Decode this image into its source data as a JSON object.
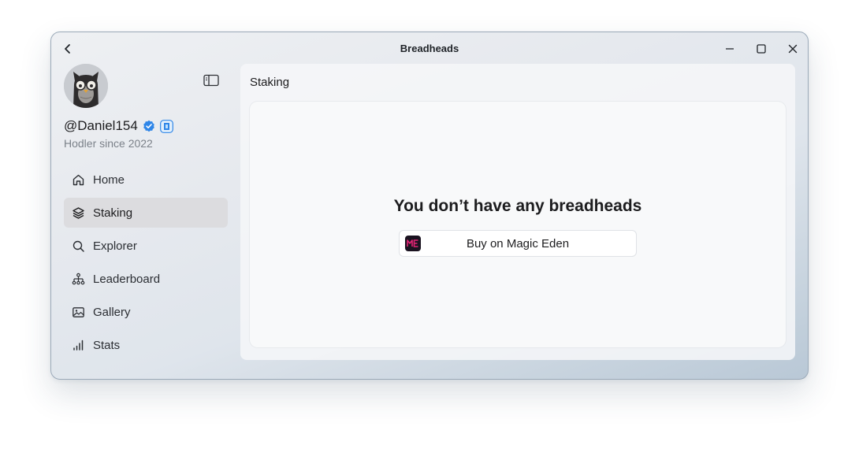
{
  "window": {
    "title": "Breadheads"
  },
  "profile": {
    "username": "@Daniel154",
    "since": "Hodler since 2022"
  },
  "nav": {
    "items": [
      {
        "label": "Home",
        "icon": "home-icon"
      },
      {
        "label": "Staking",
        "icon": "layers-icon",
        "active": true
      },
      {
        "label": "Explorer",
        "icon": "search-icon"
      },
      {
        "label": "Leaderboard",
        "icon": "hierarchy-icon"
      },
      {
        "label": "Gallery",
        "icon": "image-icon"
      },
      {
        "label": "Stats",
        "icon": "bar-chart-icon"
      }
    ]
  },
  "main": {
    "title": "Staking",
    "empty_message": "You don’t have any breadheads",
    "buy_button_label": "Buy on Magic Eden"
  },
  "colors": {
    "active_nav_bg": "#dcdcdf",
    "verified_blue": "#2f86e8",
    "magic_eden_pink": "#e42575"
  }
}
